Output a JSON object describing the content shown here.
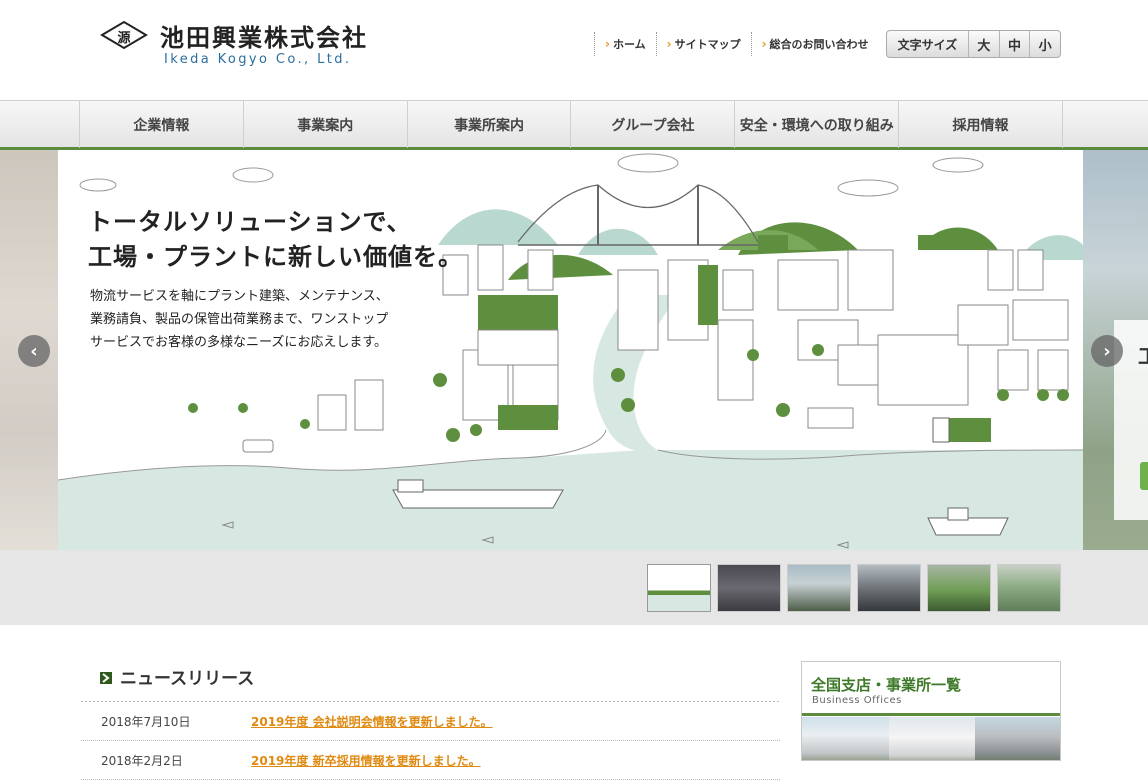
{
  "header": {
    "logo_mark": "源",
    "company_name": "池田興業株式会社",
    "company_name_en": "Ikeda Kogyo Co., Ltd."
  },
  "util_nav": [
    {
      "label": "ホーム"
    },
    {
      "label": "サイトマップ"
    },
    {
      "label": "総合のお問い合わせ"
    }
  ],
  "font_size": {
    "label": "文字サイズ",
    "large": "大",
    "medium": "中",
    "small": "小"
  },
  "global_nav": [
    {
      "label": "企業情報"
    },
    {
      "label": "事業案内"
    },
    {
      "label": "事業所案内"
    },
    {
      "label": "グループ会社"
    },
    {
      "label": "安全・環境への取り組み"
    },
    {
      "label": "採用情報"
    }
  ],
  "hero": {
    "title_line1": "トータルソリューションで、",
    "title_line2": "工場・プラントに新しい価値を。",
    "desc_line1": "物流サービスを軸にプラント建築、メンテナンス、",
    "desc_line2": "業務請負、製品の保管出荷業務まで、ワンストップ",
    "desc_line3": "サービスでお客様の多様なニーズにお応えします。",
    "prev_icon": "chevron-left-icon",
    "next_icon": "chevron-right-icon",
    "side_card_text": "工"
  },
  "thumbnails": [
    {
      "name": "illustration-city",
      "active": true
    },
    {
      "name": "warehouse-interior",
      "active": false
    },
    {
      "name": "plant-exterior",
      "active": false
    },
    {
      "name": "cargo-loading",
      "active": false
    },
    {
      "name": "truck-fleet",
      "active": false
    },
    {
      "name": "worker-portrait",
      "active": false
    }
  ],
  "news": {
    "title": "ニュースリリース",
    "items": [
      {
        "date": "2018年7月10日",
        "text": "2019年度 会社説明会情報を更新しました。"
      },
      {
        "date": "2018年2月2日",
        "text": "2019年度 新卒採用情報を更新しました。"
      }
    ]
  },
  "offices": {
    "title": "全国支店・事業所一覧",
    "subtitle": "Business Offices"
  },
  "colors": {
    "accent_green": "#5b8c3c",
    "link_orange": "#e08a12",
    "illustration_green": "#5e8f3e",
    "sea": "#d7e8e3"
  }
}
